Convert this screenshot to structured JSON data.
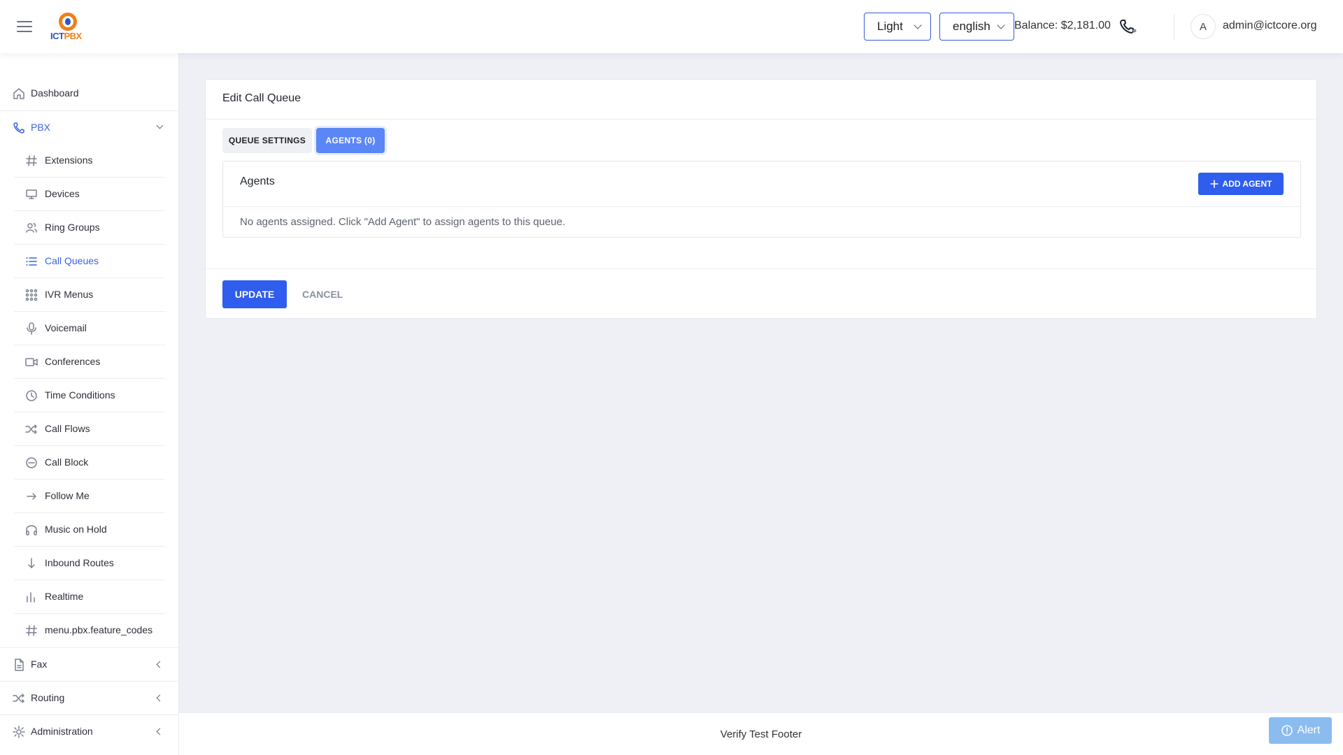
{
  "header": {
    "logo_text_a": "ICT",
    "logo_text_b": "PBX",
    "theme_value": "Light",
    "language_value": "english",
    "balance": "Balance: $2,181.00",
    "avatar_initial": "A",
    "user_email": "admin@ictcore.org"
  },
  "sidebar": {
    "dashboard": "Dashboard",
    "pbx": "PBX",
    "pbx_items": [
      {
        "label": "Extensions",
        "icon": "hash-icon"
      },
      {
        "label": "Devices",
        "icon": "monitor-icon"
      },
      {
        "label": "Ring Groups",
        "icon": "users-icon"
      },
      {
        "label": "Call Queues",
        "icon": "list-icon"
      },
      {
        "label": "IVR Menus",
        "icon": "grid-icon"
      },
      {
        "label": "Voicemail",
        "icon": "microphone-icon"
      },
      {
        "label": "Conferences",
        "icon": "video-icon"
      },
      {
        "label": "Time Conditions",
        "icon": "clock-icon"
      },
      {
        "label": "Call Flows",
        "icon": "shuffle-icon"
      },
      {
        "label": "Call Block",
        "icon": "minus-circle-icon"
      },
      {
        "label": "Follow Me",
        "icon": "arrow-right-icon"
      },
      {
        "label": "Music on Hold",
        "icon": "headphones-icon"
      },
      {
        "label": "Inbound Routes",
        "icon": "arrow-down-icon"
      },
      {
        "label": "Realtime",
        "icon": "bar-chart-icon"
      },
      {
        "label": "menu.pbx.feature_codes",
        "icon": "hash-icon"
      }
    ],
    "fax": "Fax",
    "routing": "Routing",
    "administration": "Administration"
  },
  "main": {
    "card_title": "Edit Call Queue",
    "tabs": [
      {
        "label": "QUEUE SETTINGS"
      },
      {
        "label": "AGENTS (0)"
      }
    ],
    "agents_title": "Agents",
    "add_agent_label": "ADD AGENT",
    "empty_message": "No agents assigned. Click \"Add Agent\" to assign agents to this queue.",
    "update_label": "UPDATE",
    "cancel_label": "CANCEL"
  },
  "footer": {
    "text": "Verify Test Footer",
    "alert_label": "Alert"
  },
  "colors": {
    "accent": "#2f5ded",
    "active_tab": "#5b86f5",
    "active_nav": "#3a63e0",
    "logo_orange": "#f07f1a"
  }
}
